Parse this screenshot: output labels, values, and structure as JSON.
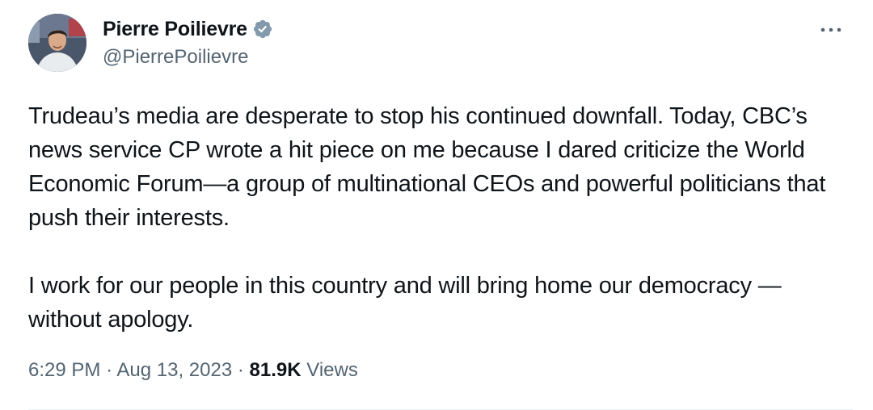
{
  "author": {
    "display_name": "Pierre Poilievre",
    "handle": "@PierrePoilievre",
    "verified": true,
    "verified_badge_color": "#829aab"
  },
  "tweet": {
    "paragraphs": [
      "Trudeau’s media are desperate to stop his continued downfall. Today, CBC’s news service CP wrote a hit piece on me because I dared criticize the World Economic Forum—a group of multinational CEOs and powerful politicians that push their interests.",
      "I work for our people in this country and will bring home our democracy —without apology."
    ]
  },
  "meta": {
    "time": "6:29 PM",
    "separator": "·",
    "date": "Aug 13, 2023",
    "views_count": "81.9K",
    "views_label": "Views"
  },
  "icons": {
    "more": "more-options-icon",
    "verified": "verified-badge-icon"
  }
}
